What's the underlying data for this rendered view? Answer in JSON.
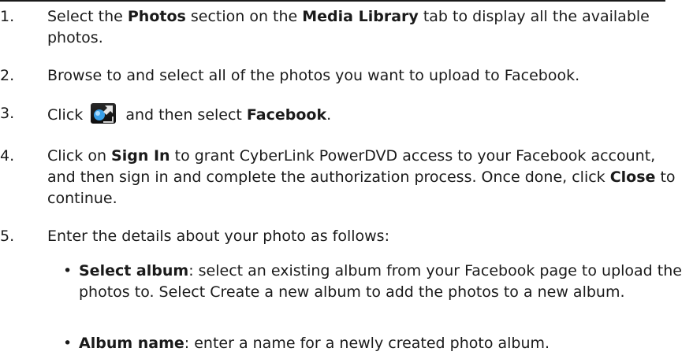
{
  "steps": [
    {
      "num": "1.",
      "parts": [
        "Select the ",
        "Photos",
        " section on the ",
        "Media Library",
        " tab to display all the available photos."
      ]
    },
    {
      "num": "2.",
      "text": "Browse to and select all of the photos you want to upload to Facebook."
    },
    {
      "num": "3.",
      "pre": "Click",
      "icon": "share-icon",
      "mid": " and then select ",
      "bold": "Facebook",
      "post": "."
    },
    {
      "num": "4.",
      "parts": [
        "Click on ",
        "Sign In",
        " to grant CyberLink PowerDVD access to your Facebook account, and then sign in and complete the authorization process. Once done, click ",
        "Close",
        " to continue."
      ]
    },
    {
      "num": "5.",
      "text": "Enter the details about your photo as follows:"
    }
  ],
  "bullets": [
    {
      "bold": "Select album",
      "text": ": select an existing album from your Facebook page to upload the photos to. Select Create a new album to add the photos to a new album."
    },
    {
      "bold": "Album name",
      "text": ": enter a name for a newly created photo album."
    }
  ],
  "bullet_char": "•"
}
